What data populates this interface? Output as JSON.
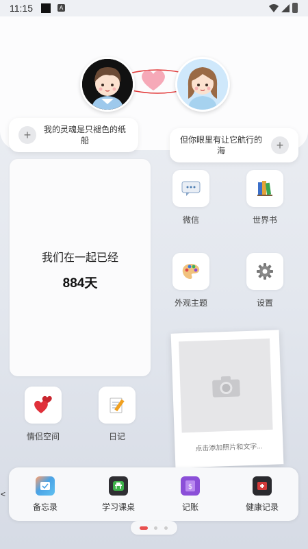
{
  "status_bar": {
    "time": "11:15",
    "badge": "A"
  },
  "couple": {
    "left_note": "我的灵魂是只褪色的纸船",
    "right_note": "但你眼里有让它航行的海",
    "plus": "+"
  },
  "days": {
    "label": "我们在一起已经",
    "value": "884天"
  },
  "apps": [
    {
      "label": "微信",
      "icon": "wechat-chat-icon"
    },
    {
      "label": "世界书",
      "icon": "books-icon"
    },
    {
      "label": "外观主题",
      "icon": "palette-icon"
    },
    {
      "label": "设置",
      "icon": "gear-icon"
    },
    {
      "label": "情侣空间",
      "icon": "hearts-icon"
    },
    {
      "label": "日记",
      "icon": "memo-pencil-icon"
    }
  ],
  "photo": {
    "caption": "点击添加照片和文字..."
  },
  "dock": {
    "back": "<",
    "items": [
      {
        "label": "备忘录",
        "icon": "memo-icon",
        "color": "#4aa3e6"
      },
      {
        "label": "学习课桌",
        "icon": "desk-icon",
        "color": "#3db34a"
      },
      {
        "label": "记账",
        "icon": "ledger-icon",
        "color": "#8b4fd8"
      },
      {
        "label": "健康记录",
        "icon": "health-icon",
        "color": "#d23a3a"
      }
    ]
  },
  "pager": {
    "active": 0,
    "count": 3,
    "accent": "#e8504f"
  }
}
